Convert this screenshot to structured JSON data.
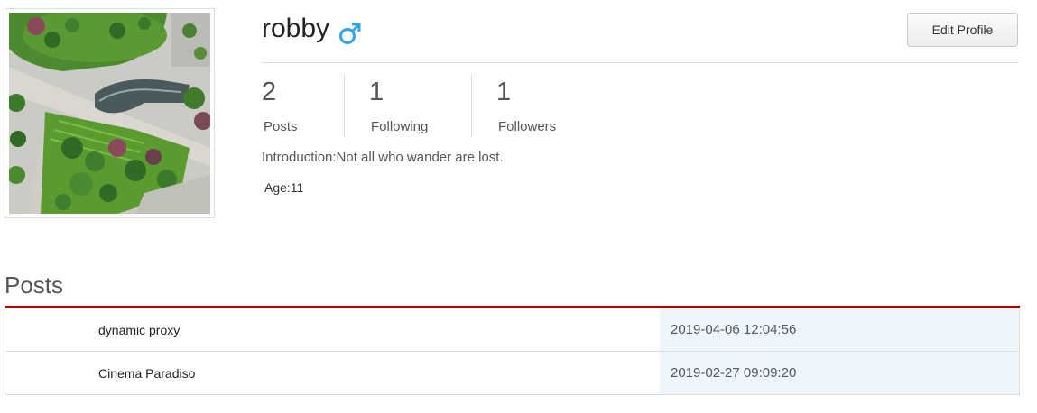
{
  "profile": {
    "username": "robby",
    "gender_icon": "male-symbol-icon",
    "edit_button_label": "Edit Profile",
    "introduction": "Introduction:Not all who wander are lost.",
    "age": "Age:11",
    "avatar_icon": "avatar-landscape-photo"
  },
  "stats": {
    "posts": {
      "value": "2",
      "label": "Posts"
    },
    "following": {
      "value": "1",
      "label": "Following"
    },
    "followers": {
      "value": "1",
      "label": "Followers"
    }
  },
  "posts_section": {
    "title": "Posts",
    "rows": [
      {
        "title": "dynamic proxy",
        "date": "2019-04-06 12:04:56"
      },
      {
        "title": "Cinema Paradiso",
        "date": "2019-02-27 09:09:20"
      }
    ]
  },
  "colors": {
    "accent_red": "#b30000",
    "gender_blue": "#2fa4e7",
    "date_cell_bg": "#eef6fd"
  }
}
